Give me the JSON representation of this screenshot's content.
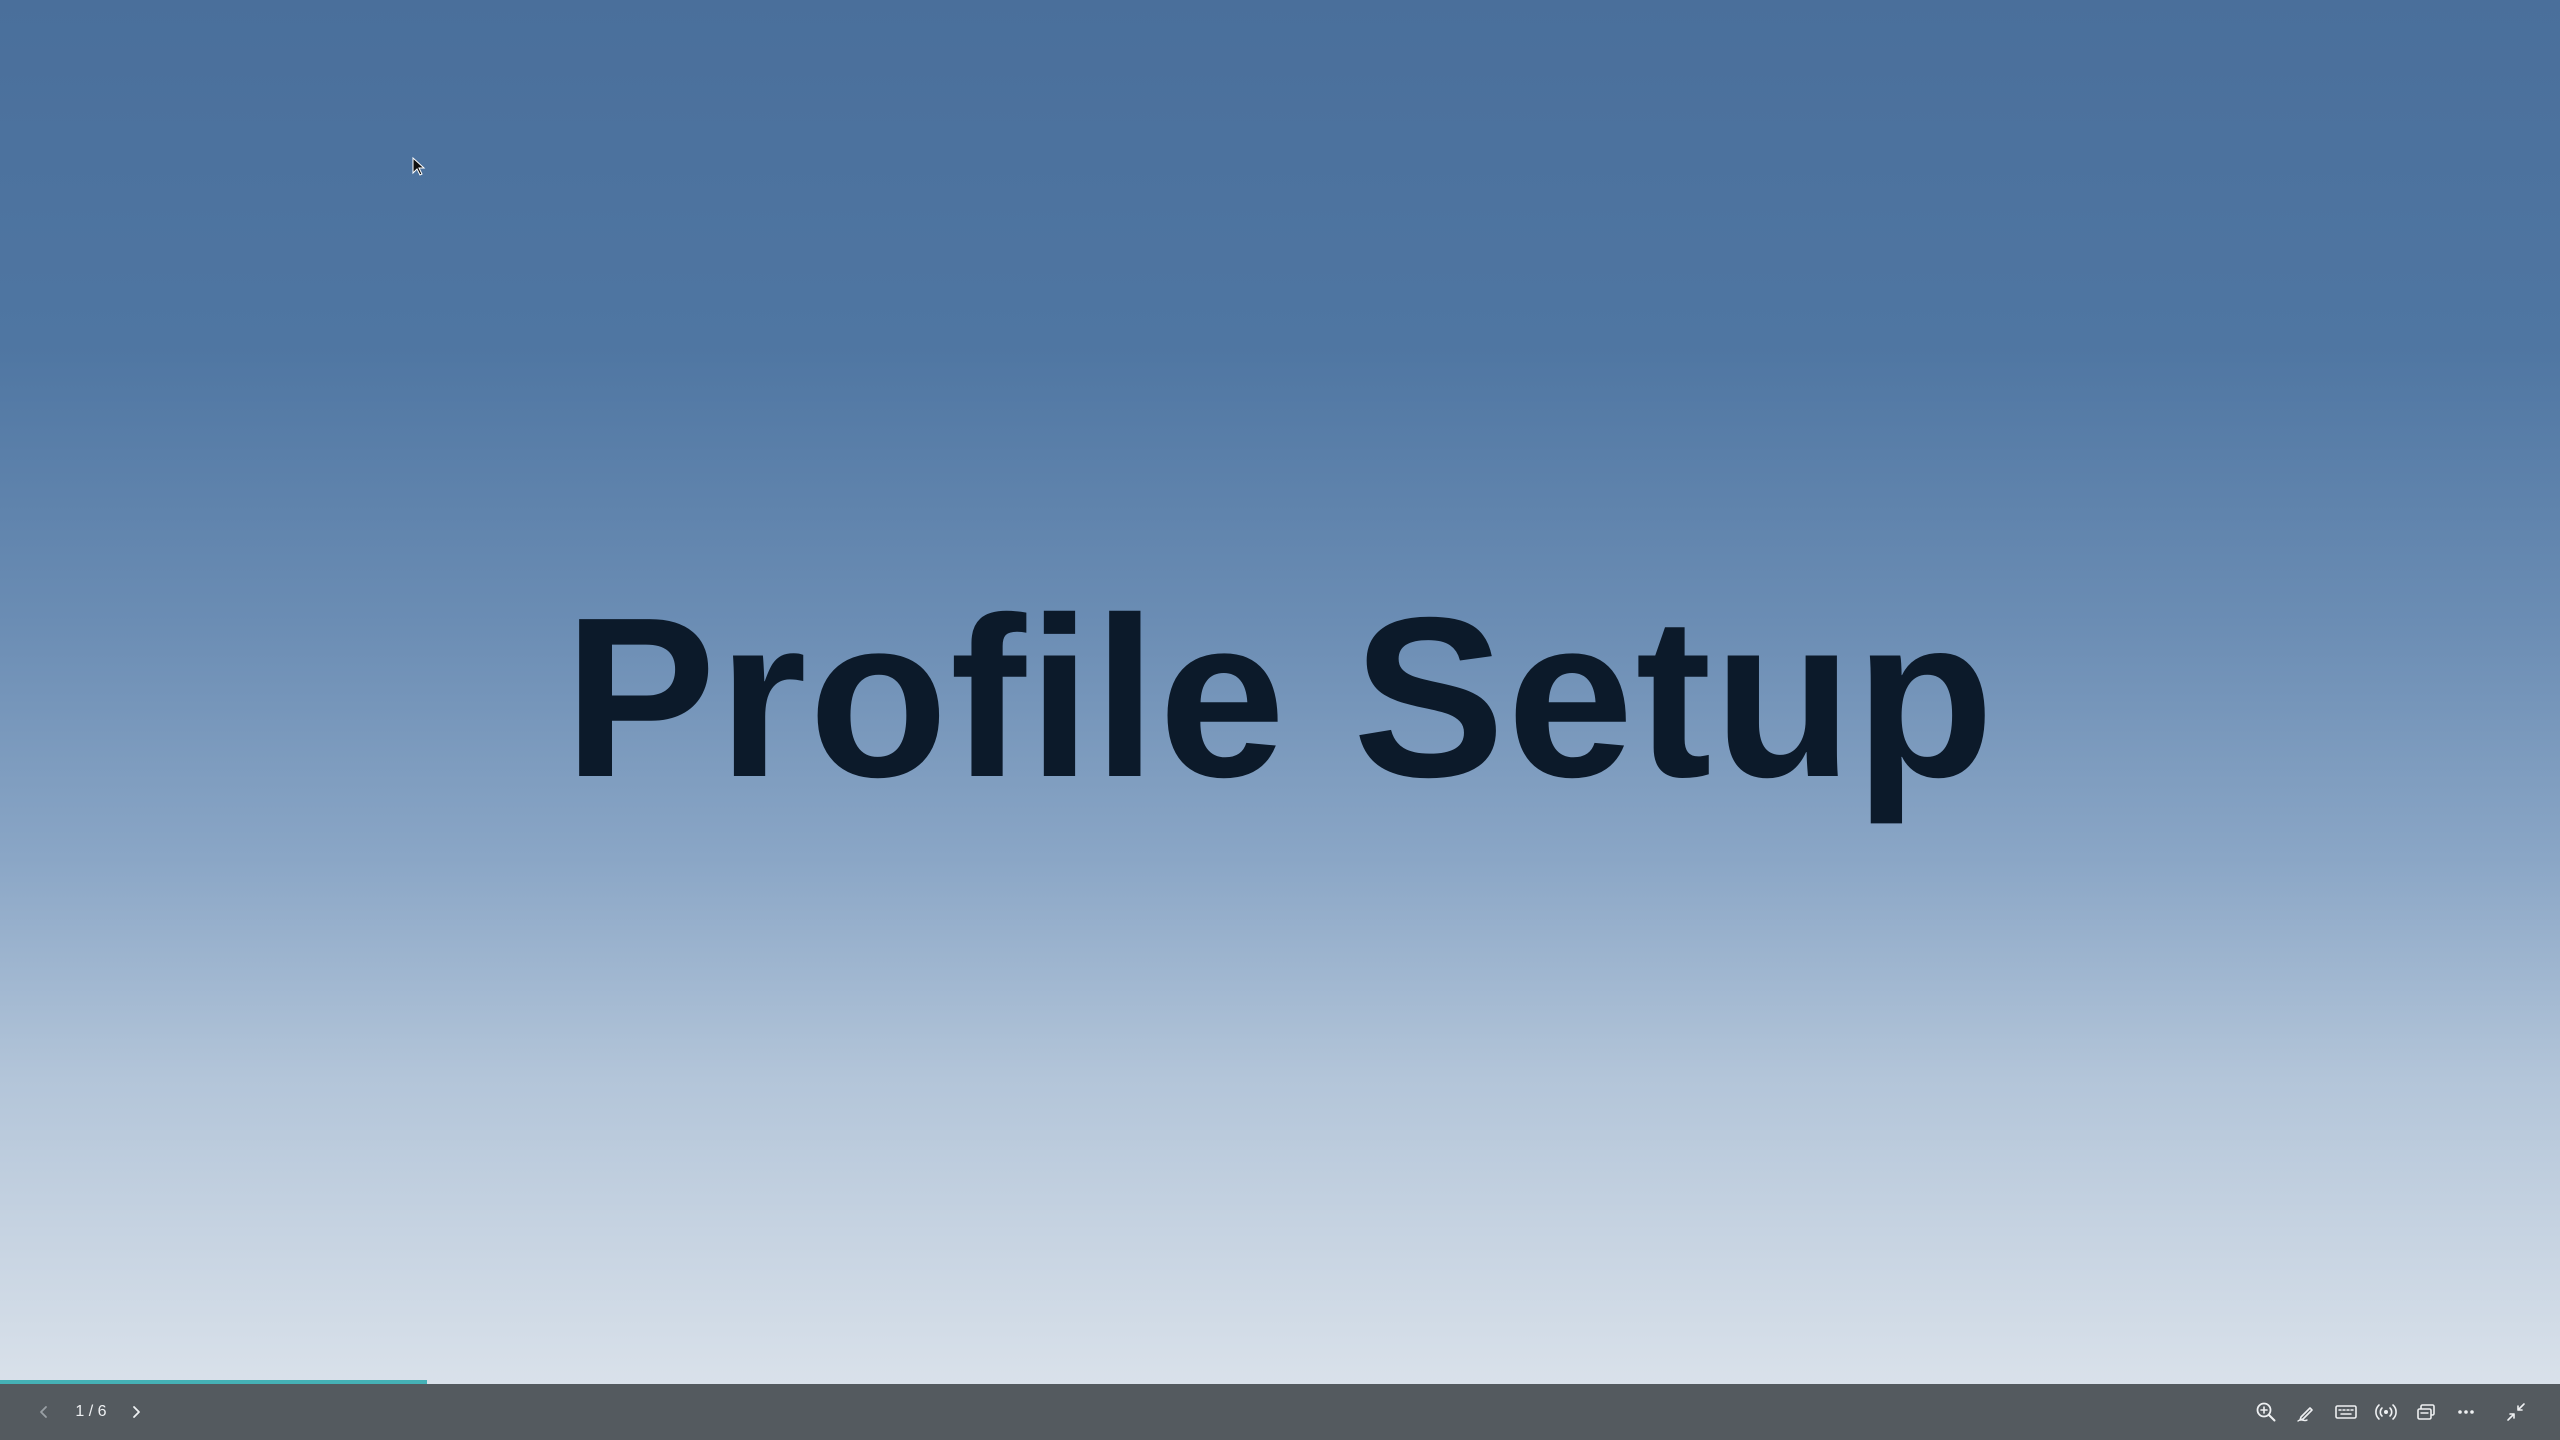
{
  "slide": {
    "title": "Profile Setup"
  },
  "toolbar": {
    "page_indicator": "1 / 6",
    "progress": 0.1667,
    "buttons": [
      {
        "name": "previous-slide-button",
        "icon": "chevron-left-icon"
      },
      {
        "name": "next-slide-button",
        "icon": "chevron-right-icon"
      },
      {
        "name": "zoom-button",
        "icon": "zoom-in-icon"
      },
      {
        "name": "pen-button",
        "icon": "pen-icon"
      },
      {
        "name": "keyboard-button",
        "icon": "keyboard-icon"
      },
      {
        "name": "live-broadcast-button",
        "icon": "broadcast-icon"
      },
      {
        "name": "presenter-view-button",
        "icon": "windows-icon"
      },
      {
        "name": "more-options-button",
        "icon": "more-horizontal-icon"
      },
      {
        "name": "exit-fullscreen-button",
        "icon": "minimize-icon"
      }
    ]
  },
  "colors": {
    "accent": "#45b1b6",
    "toolbar_bg": "#545a5f",
    "title_color": "#0c1a2a"
  }
}
